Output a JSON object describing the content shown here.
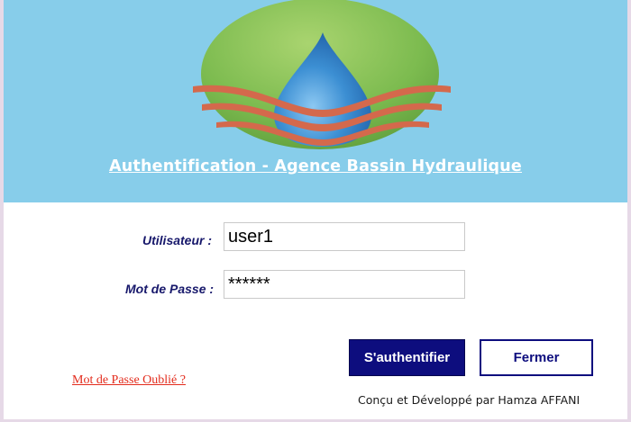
{
  "header": {
    "title": "Authentification - Agence Bassin Hydraulique",
    "background_color": "#87cdea",
    "logo_icon": "water-drop-logo-icon"
  },
  "form": {
    "user_label": "Utilisateur :",
    "user_value": "user1",
    "password_label": "Mot de Passe :",
    "password_value": "******"
  },
  "buttons": {
    "authenticate_label": "S'authentifier",
    "close_label": "Fermer"
  },
  "forgot_password_link": "Mot de Passe Oublié ?",
  "footer": {
    "credit": "Conçu et Développé par Hamza AFFANI"
  },
  "colors": {
    "label_text": "#17186b",
    "primary_button": "#0d0d7e",
    "link": "#e32c1d",
    "logo_ellipse_green": "#7cbb4f",
    "logo_waves": "#d4694c",
    "logo_drop": "#3c8fd3"
  }
}
